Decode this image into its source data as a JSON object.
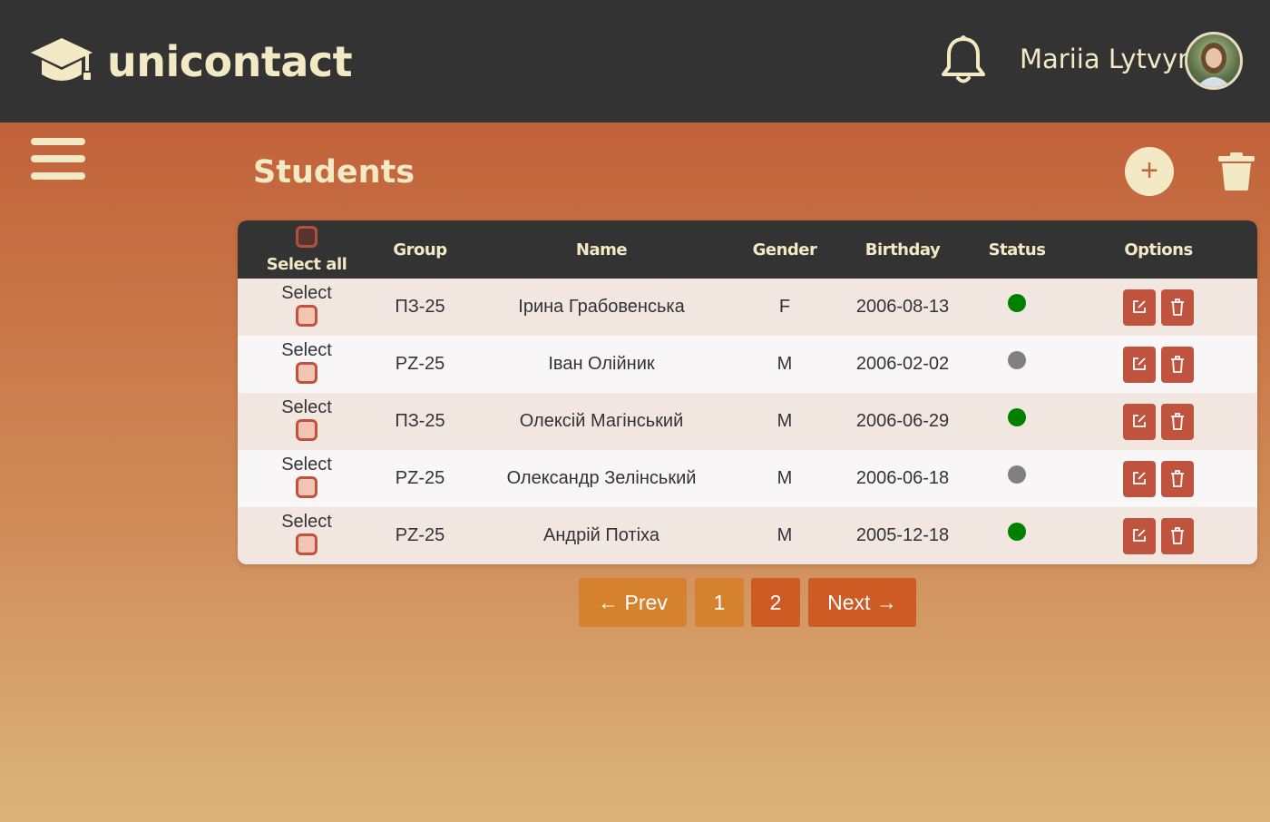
{
  "app": {
    "name": "unicontact"
  },
  "header": {
    "user_name": "Mariia Lytvyn"
  },
  "page": {
    "title": "Students",
    "add_label": "+"
  },
  "table": {
    "select_all_label": "Select all",
    "columns": [
      "Group",
      "Name",
      "Gender",
      "Birthday",
      "Status",
      "Options"
    ],
    "select_label": "Select",
    "rows": [
      {
        "group": "ПЗ-25",
        "name": "Ірина Грабовенська",
        "gender": "F",
        "birthday": "2006-08-13",
        "status": "active"
      },
      {
        "group": "PZ-25",
        "name": "Іван Олійник",
        "gender": "M",
        "birthday": "2006-02-02",
        "status": "inactive"
      },
      {
        "group": "ПЗ-25",
        "name": "Олексій Магінський",
        "gender": "M",
        "birthday": "2006-06-29",
        "status": "active"
      },
      {
        "group": "PZ-25",
        "name": "Олександр Зелінський",
        "gender": "M",
        "birthday": "2006-06-18",
        "status": "inactive"
      },
      {
        "group": "PZ-25",
        "name": "Андрій Потіха",
        "gender": "M",
        "birthday": "2005-12-18",
        "status": "active"
      }
    ]
  },
  "pagination": {
    "prev": "← Prev",
    "pages": [
      "1",
      "2"
    ],
    "current": "2",
    "next": "Next →"
  },
  "colors": {
    "header_bg": "#333333",
    "accent_cream": "#f3e9c4",
    "action_red": "#c0533e",
    "status_active": "#008000",
    "status_inactive": "#808080",
    "page_btn": "#d6812e",
    "page_btn_active": "#cf5b24"
  },
  "icons": [
    "graduation-cap-icon",
    "bell-icon",
    "hamburger-icon",
    "plus-icon",
    "trash-icon",
    "edit-icon"
  ]
}
